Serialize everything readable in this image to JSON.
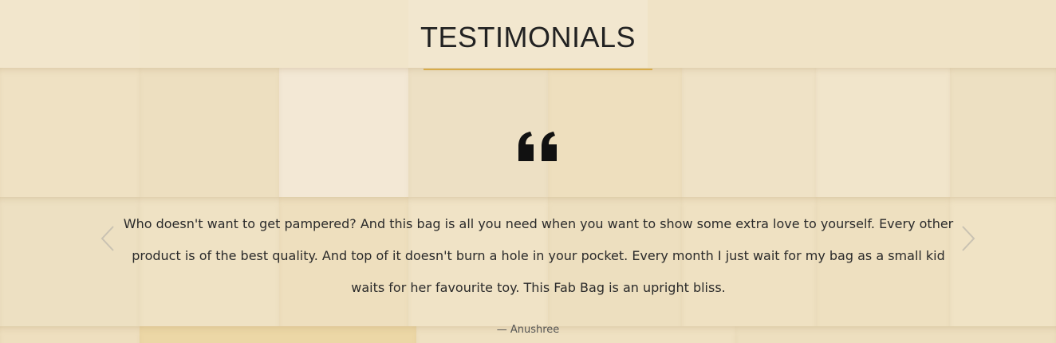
{
  "section": {
    "title": "TESTIMONIALS",
    "accent_color": "#d8ac4b"
  },
  "testimonial": {
    "quote_icon": "quote-open-icon",
    "text": "Who doesn't want to get pampered? And this bag is all you need when you want to show some extra love to yourself. Every other product is of the best quality. And top of it doesn't burn a hole in your pocket. Every month I just wait for my bag as a small kid waits for her favourite toy. This Fab Bag is an upright bliss.",
    "author": "— Anushree"
  },
  "carousel": {
    "prev_icon": "chevron-left-icon",
    "next_icon": "chevron-right-icon"
  }
}
